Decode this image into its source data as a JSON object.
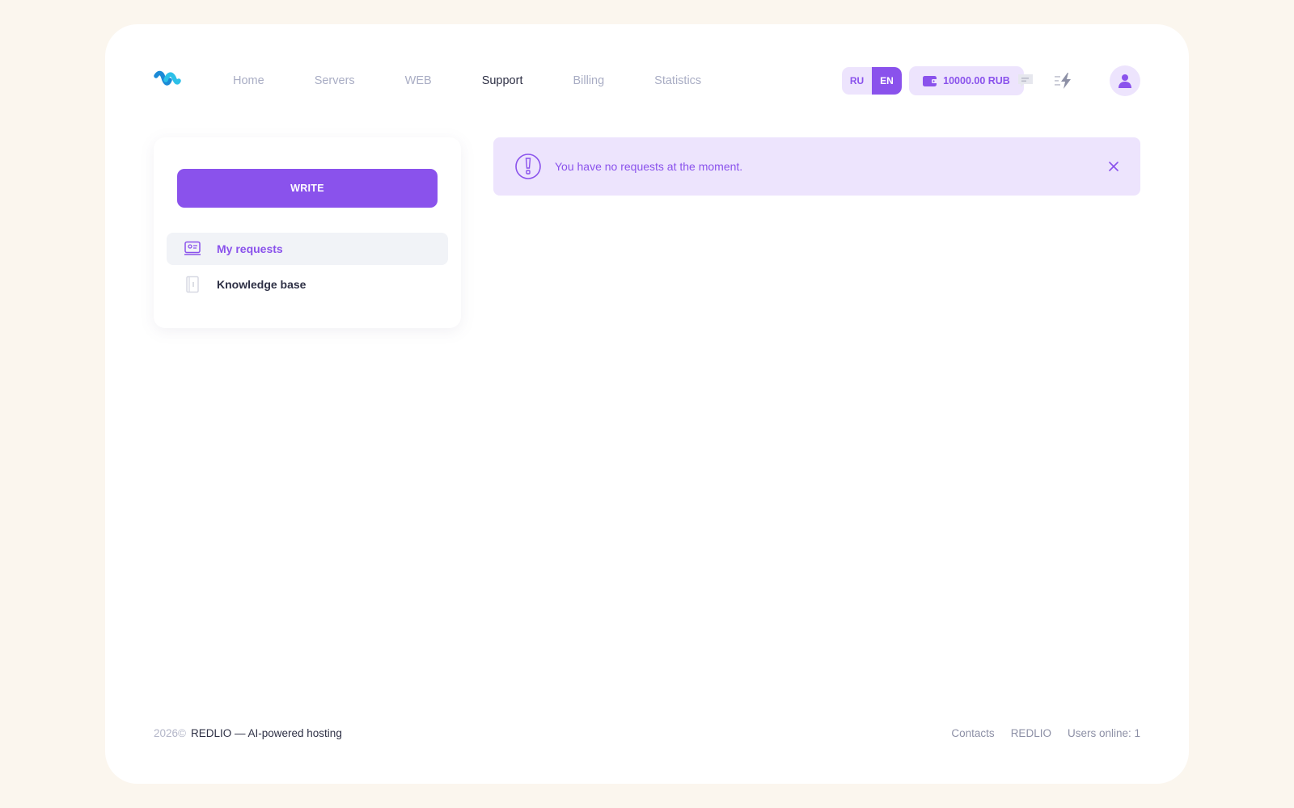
{
  "header": {
    "nav": [
      {
        "label": "Home"
      },
      {
        "label": "Servers"
      },
      {
        "label": "WEB"
      },
      {
        "label": "Support",
        "active": true
      },
      {
        "label": "Billing"
      },
      {
        "label": "Statistics"
      }
    ],
    "lang": {
      "ru": "RU",
      "en": "EN",
      "selected": "EN"
    },
    "balance": "10000.00 RUB",
    "icons": [
      "logo-icon",
      "wallet-icon",
      "chat-icon",
      "lightning-icon",
      "user-icon"
    ]
  },
  "sidebar": {
    "write_label": "WRITE",
    "items": [
      {
        "label": "My requests",
        "icon": "support-tickets-icon",
        "active": true
      },
      {
        "label": "Knowledge base",
        "icon": "book-icon",
        "active": false
      }
    ]
  },
  "alert": {
    "message": "You have no requests at the moment.",
    "icon": "exclamation-icon",
    "close_icon": "close-icon"
  },
  "footer": {
    "year": "2026©",
    "brand_text": "REDLIO — AI-powered hosting",
    "links": [
      "Contacts",
      "REDLIO"
    ],
    "users_online": "Users online: 1"
  },
  "colors": {
    "accent": "#8a52ec",
    "accent_soft": "#ede4fd",
    "page_bg": "#fbf6ee",
    "text_dark": "#2e3045",
    "text_muted": "#a9adc4"
  }
}
